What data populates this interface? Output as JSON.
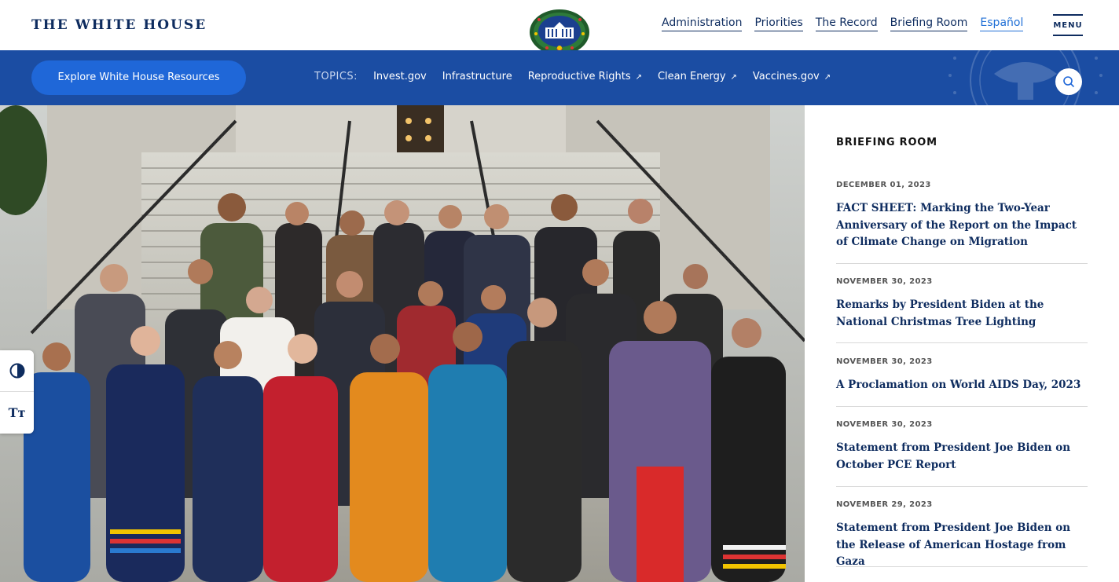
{
  "header": {
    "site_title": "THE WHITE HOUSE",
    "nav": [
      "Administration",
      "Priorities",
      "The Record",
      "Briefing Room",
      "Español"
    ],
    "menu_label": "MENU"
  },
  "topics_bar": {
    "resources_button": "Explore White House Resources",
    "topics_label": "TOPICS:",
    "topics": [
      {
        "label": "Invest.gov",
        "external": false
      },
      {
        "label": "Infrastructure",
        "external": false
      },
      {
        "label": "Reproductive Rights",
        "external": true
      },
      {
        "label": "Clean Energy",
        "external": true
      },
      {
        "label": "Vaccines.gov",
        "external": true
      }
    ],
    "external_glyph": "↗"
  },
  "hero": {
    "image": "group-photo-on-steps"
  },
  "accessibility": {
    "contrast_icon": "contrast-icon",
    "text_size_label": "Tт"
  },
  "briefing_room": {
    "heading": "BRIEFING ROOM",
    "posts": [
      {
        "date": "DECEMBER 01, 2023",
        "title": "FACT SHEET: Marking the Two-Year Anniversary of the Report on the Impact of Climate Change on Migration"
      },
      {
        "date": "NOVEMBER 30, 2023",
        "title": "Remarks by President Biden at the National Christmas Tree Lighting"
      },
      {
        "date": "NOVEMBER 30, 2023",
        "title": "A Proclamation on World AIDS Day, 2023"
      },
      {
        "date": "NOVEMBER 30, 2023",
        "title": "Statement from President Joe Biden on October PCE Report"
      },
      {
        "date": "NOVEMBER 29, 2023",
        "title": "Statement from President Joe Biden on the Release of American Hostage from Gaza"
      }
    ]
  },
  "colors": {
    "navy": "#0e2c5f",
    "topics_bar": "#1b4da3",
    "button_blue": "#1f67d8",
    "link_blue": "#1f6fd6"
  }
}
